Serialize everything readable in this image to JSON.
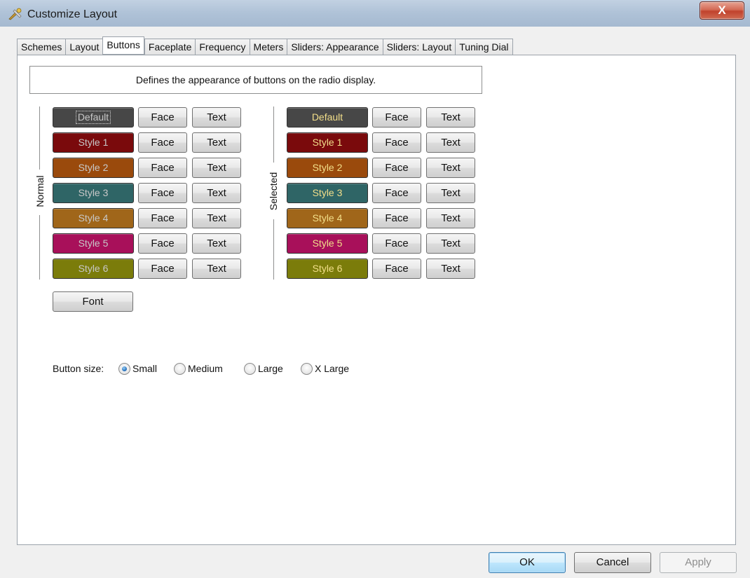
{
  "window": {
    "title": "Customize Layout",
    "close_glyph": "X"
  },
  "tabs": [
    {
      "label": "Schemes",
      "active": false
    },
    {
      "label": "Layout",
      "active": false
    },
    {
      "label": "Buttons",
      "active": true
    },
    {
      "label": "Faceplate",
      "active": false
    },
    {
      "label": "Frequency",
      "active": false
    },
    {
      "label": "Meters",
      "active": false
    },
    {
      "label": "Sliders: Appearance",
      "active": false
    },
    {
      "label": "Sliders: Layout",
      "active": false
    },
    {
      "label": "Tuning Dial",
      "active": false
    }
  ],
  "description": "Defines the appearance of buttons on the radio display.",
  "face_label": "Face",
  "text_label": "Text",
  "groups": {
    "normal": {
      "label": "Normal",
      "text_color": "#c8c8c8",
      "styles": [
        {
          "label": "Default",
          "color": "#474747"
        },
        {
          "label": "Style 1",
          "color": "#7a0a0c"
        },
        {
          "label": "Style 2",
          "color": "#9a4a0c"
        },
        {
          "label": "Style 3",
          "color": "#2f6566"
        },
        {
          "label": "Style 4",
          "color": "#a0661a"
        },
        {
          "label": "Style 5",
          "color": "#a8105a"
        },
        {
          "label": "Style 6",
          "color": "#7b7c0a"
        }
      ]
    },
    "selected": {
      "label": "Selected",
      "text_color": "#f3df8a",
      "styles": [
        {
          "label": "Default",
          "color": "#474747"
        },
        {
          "label": "Style 1",
          "color": "#7a0a0c"
        },
        {
          "label": "Style 2",
          "color": "#9a4a0c"
        },
        {
          "label": "Style 3",
          "color": "#2f6566"
        },
        {
          "label": "Style 4",
          "color": "#a0661a"
        },
        {
          "label": "Style 5",
          "color": "#a8105a"
        },
        {
          "label": "Style 6",
          "color": "#7b7c0a"
        }
      ]
    }
  },
  "font_button": "Font",
  "button_size": {
    "label": "Button size:",
    "options": [
      {
        "label": "Small",
        "checked": true
      },
      {
        "label": "Medium",
        "checked": false
      },
      {
        "label": "Large",
        "checked": false
      },
      {
        "label": "X Large",
        "checked": false
      }
    ]
  },
  "footer": {
    "ok": "OK",
    "cancel": "Cancel",
    "apply": "Apply"
  }
}
